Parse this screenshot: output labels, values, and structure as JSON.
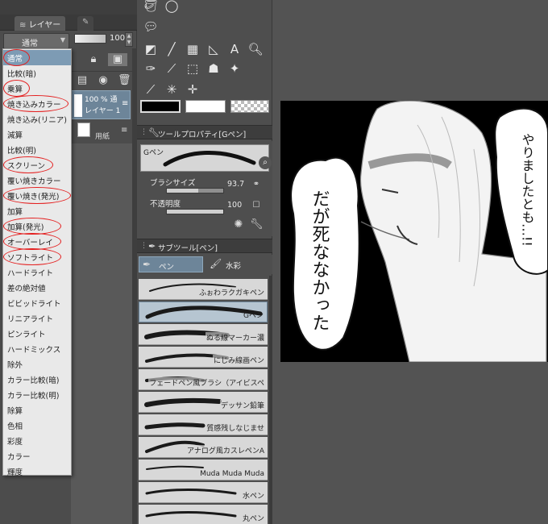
{
  "layer_panel": {
    "tab_label": "レイヤー",
    "blend_mode_value": "通常",
    "opacity_value": "100",
    "layers": [
      {
        "opacity": "100 %  通",
        "name": "レイヤー 1"
      },
      {
        "name": "用紙"
      }
    ]
  },
  "blend_modes": [
    "通常",
    "比較(暗)",
    "乗算",
    "焼き込みカラー",
    "焼き込み(リニア)",
    "減算",
    "比較(明)",
    "スクリーン",
    "覆い焼きカラー",
    "覆い焼き(発光)",
    "加算",
    "加算(発光)",
    "オーバーレイ",
    "ソフトライト",
    "ハードライト",
    "差の絶対値",
    "ビビッドライト",
    "リニアライト",
    "ピンライト",
    "ハードミックス",
    "除外",
    "カラー比較(暗)",
    "カラー比較(明)",
    "除算",
    "色相",
    "彩度",
    "カラー",
    "輝度"
  ],
  "blend_selected_index": 0,
  "circled_blend_modes": [
    "通常",
    "乗算",
    "焼き込みカラー",
    "スクリーン",
    "覆い焼き(発光)",
    "加算(発光)",
    "オーバーレイ",
    "ソフトライト"
  ],
  "tool_property": {
    "header": "ツールプロパティ[Gペン]",
    "brush_label": "Gペン",
    "brush_size_label": "ブラシサイズ",
    "brush_size_value": "93.7",
    "brush_size_fraction": 0.55,
    "opacity_label": "不透明度",
    "opacity_value": "100",
    "opacity_fraction": 1.0
  },
  "sub_tool": {
    "header": "サブツール[ペン]",
    "tab_pen": "ペン",
    "tab_watercolor": "水彩",
    "items": [
      "ふぉわラクガキペン",
      "Gペン",
      "ぬる線マーカー濃",
      "にじみ線画ペン",
      "フェードペン風ブラシ（アイビスペ",
      "デッサン鉛筆",
      "質感残しなじませ",
      "アナログ風カスレペンA",
      "Muda Muda Muda",
      "水ペン",
      "丸ペン"
    ],
    "selected_index": 1
  },
  "canvas": {
    "speech_left": "だが死ななかった",
    "speech_right": "やりましたとも…!!"
  },
  "colors": {
    "selection_blue": "#7d9bb4",
    "circle_red": "#e41e1e",
    "main_color": "#000000",
    "sub_color": "#ffffff"
  }
}
